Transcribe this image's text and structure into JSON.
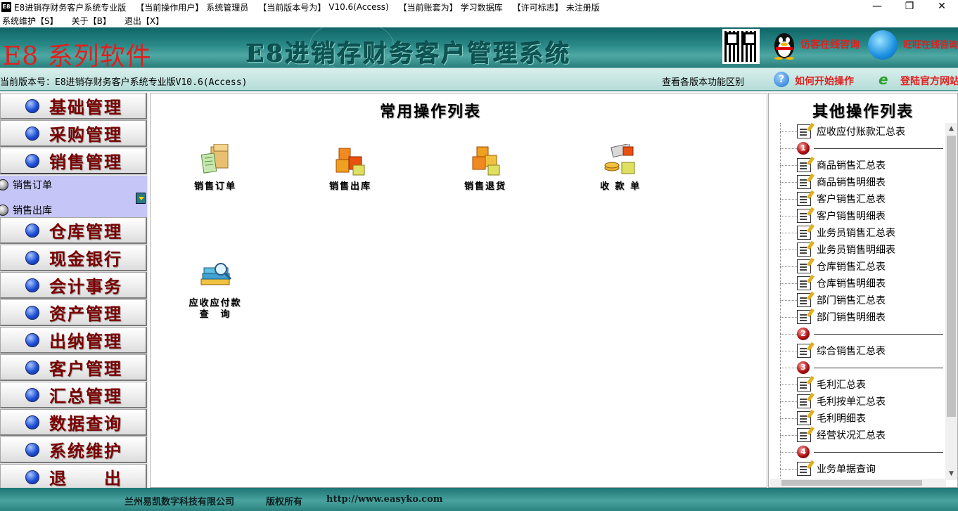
{
  "titlebar": {
    "app_icon": "E8",
    "title": "E8进销存财务客户系统专业版",
    "user_label": "【当前操作用户】",
    "user_value": "系统管理员",
    "version_label": "【当前版本号为】",
    "version_value": "V10.6(Access)",
    "account_label": "【当前账套为】",
    "account_value": "学习数据库",
    "license_label": "【许可标志】",
    "license_value": "未注册版",
    "minimize": "—",
    "maximize": "❐",
    "close": "✕"
  },
  "menubar": {
    "items": [
      "系统维护【S】",
      "关于【B】",
      "退出【X】"
    ]
  },
  "banner": {
    "brand": "E8 系列软件",
    "title": "E8进销存财务客户管理系统",
    "qq_label": "访客在线咨询",
    "chat_label": "旺旺在线咨询"
  },
  "versionbar": {
    "current_version": "当前版本号：E8进销存财务客户系统专业版V10.6(Access)",
    "compare_link": "查看各版本功能区别",
    "help_icon": "?",
    "howto_link": "如何开始操作",
    "ie_icon": "e",
    "site_link": "登陆官方网站"
  },
  "leftnav": {
    "items": [
      "基础管理",
      "采购管理",
      "销售管理",
      "仓库管理",
      "现金银行",
      "会计事务",
      "资产管理",
      "出纳管理",
      "客户管理",
      "汇总管理",
      "数据查询",
      "系统维护",
      "退　　出"
    ],
    "sub_items": [
      "销售订单",
      "销售出库"
    ]
  },
  "center": {
    "title": "常用操作列表",
    "ops": [
      {
        "label": "销售订单",
        "icon": "sales-order-icon"
      },
      {
        "label": "销售出库",
        "icon": "sales-outbound-icon"
      },
      {
        "label": "销售退货",
        "icon": "sales-return-icon"
      },
      {
        "label": "收 款 单",
        "icon": "receipt-icon"
      },
      {
        "label1": "应收应付款",
        "label2": "查　询",
        "icon": "receivable-query-icon"
      }
    ]
  },
  "right": {
    "title": "其他操作列表",
    "rows": [
      {
        "type": "doc",
        "text": "应收应付账款汇总表"
      },
      {
        "type": "sep",
        "num": "1"
      },
      {
        "type": "doc",
        "text": "商品销售汇总表"
      },
      {
        "type": "doc",
        "text": "商品销售明细表"
      },
      {
        "type": "doc",
        "text": "客户销售汇总表"
      },
      {
        "type": "doc",
        "text": "客户销售明细表"
      },
      {
        "type": "doc",
        "text": "业务员销售汇总表"
      },
      {
        "type": "doc",
        "text": "业务员销售明细表"
      },
      {
        "type": "doc",
        "text": "仓库销售汇总表"
      },
      {
        "type": "doc",
        "text": "仓库销售明细表"
      },
      {
        "type": "doc",
        "text": "部门销售汇总表"
      },
      {
        "type": "doc",
        "text": "部门销售明细表"
      },
      {
        "type": "sep",
        "num": "2"
      },
      {
        "type": "doc",
        "text": "综合销售汇总表"
      },
      {
        "type": "sep",
        "num": "3"
      },
      {
        "type": "doc",
        "text": "毛利汇总表"
      },
      {
        "type": "doc",
        "text": "毛利按单汇总表"
      },
      {
        "type": "doc",
        "text": "毛利明细表"
      },
      {
        "type": "doc",
        "text": "经营状况汇总表"
      },
      {
        "type": "sep",
        "num": "4"
      },
      {
        "type": "doc",
        "text": "业务单据查询"
      }
    ]
  },
  "footer": {
    "company": "兰州易凯数字科技有限公司",
    "rights": "版权所有",
    "url": "http://www.easyko.com"
  }
}
